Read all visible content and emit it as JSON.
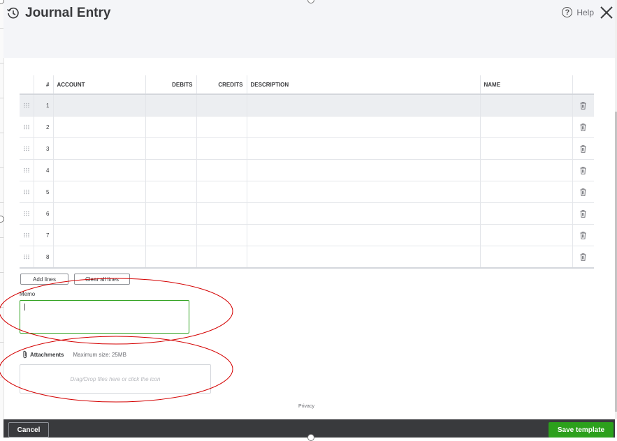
{
  "header": {
    "title": "Journal Entry",
    "help_label": "Help",
    "title_icon": "history-clock-icon",
    "help_icon": "question-circle-icon",
    "close_icon": "close-x-icon"
  },
  "table": {
    "columns": [
      "#",
      "ACCOUNT",
      "DEBITS",
      "CREDITS",
      "DESCRIPTION",
      "NAME"
    ],
    "rows": [
      {
        "num": "1",
        "active": true
      },
      {
        "num": "2",
        "active": false
      },
      {
        "num": "3",
        "active": false
      },
      {
        "num": "4",
        "active": false
      },
      {
        "num": "5",
        "active": false
      },
      {
        "num": "6",
        "active": false
      },
      {
        "num": "7",
        "active": false
      },
      {
        "num": "8",
        "active": false
      }
    ],
    "row_icons": {
      "drag": "drag-handle-icon",
      "delete": "trash-icon"
    }
  },
  "actions": {
    "add_lines": "Add lines",
    "clear_all_lines": "Clear all lines"
  },
  "memo": {
    "label": "Memo",
    "value": ""
  },
  "attachments": {
    "label": "Attachments",
    "max_size": "Maximum size: 25MB",
    "dropzone": "Drag/Drop files here or click the icon",
    "icon": "paperclip-icon"
  },
  "privacy": "Privacy",
  "footer": {
    "cancel": "Cancel",
    "save_template": "Save template"
  },
  "colors": {
    "primary_green": "#2ca01c",
    "footer_dark": "#393a3d",
    "header_band": "#f4f5f8",
    "annotation_red": "#d40000"
  }
}
